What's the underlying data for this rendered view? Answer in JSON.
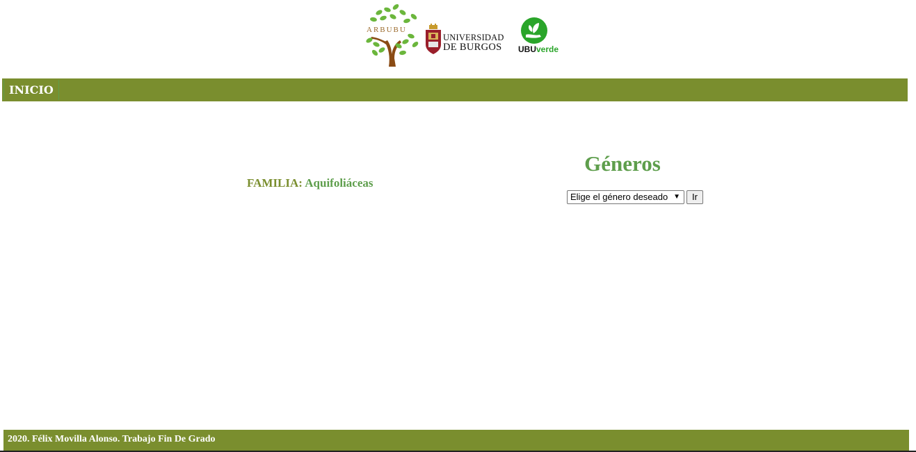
{
  "header": {
    "logos": {
      "arbubu": "ARBUBU",
      "ubu_line1": "UNIVERSIDAD",
      "ubu_line2": "DE BURGOS",
      "ubuverde_a": "UBU",
      "ubuverde_b": "verde"
    }
  },
  "nav": {
    "items": [
      {
        "label": "INICIO"
      }
    ]
  },
  "familia": {
    "label": "FAMILIA:",
    "value": "Aquifoliáceas"
  },
  "generos": {
    "title": "Géneros",
    "select_value": "Elige el género deseado",
    "button_label": "Ir"
  },
  "footer": {
    "text": "2020. Félix Movilla Alonso. Trabajo Fin De Grado"
  },
  "colors": {
    "bar": "#7a8e2e",
    "accent": "#5e9e4c"
  }
}
